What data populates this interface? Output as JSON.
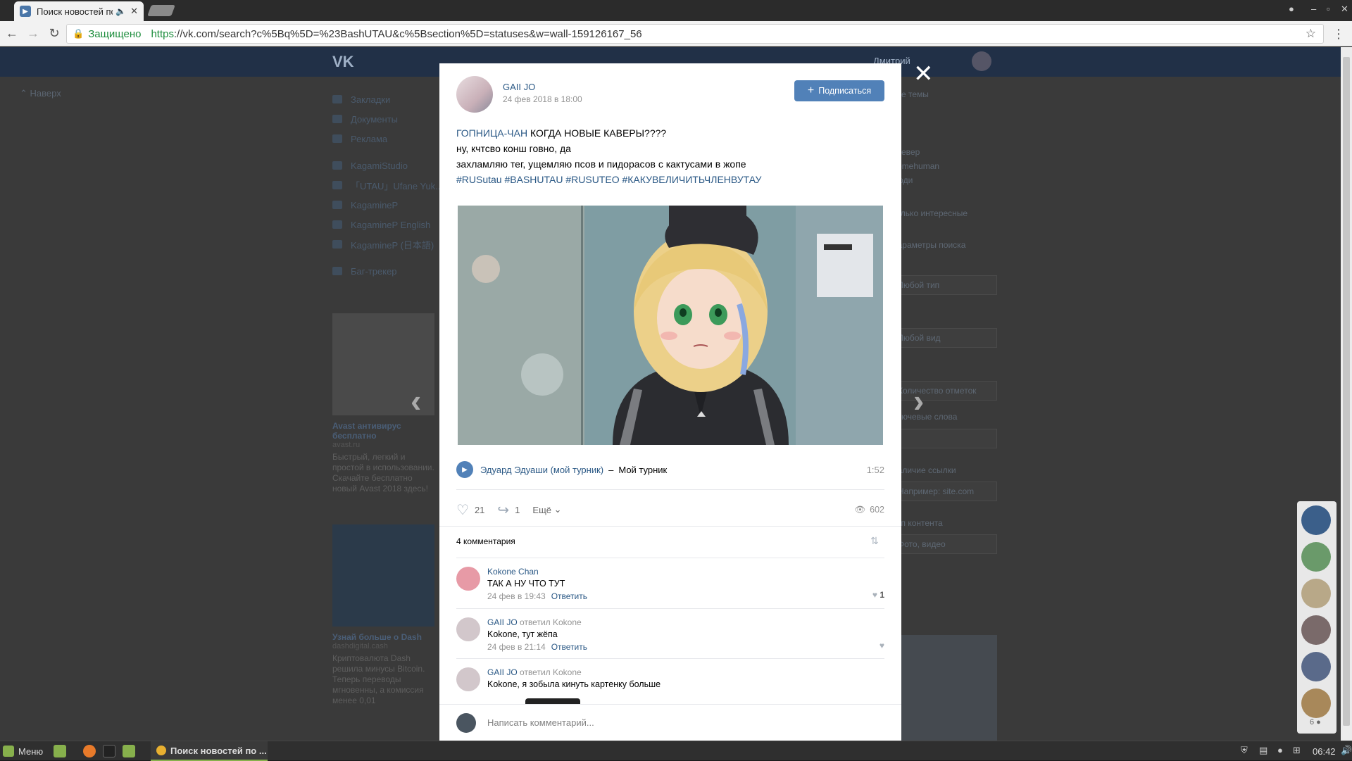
{
  "browser": {
    "tab_title": "Поиск новостей по",
    "secure_label": "Защищено",
    "url_scheme": "https",
    "url_rest": "://vk.com/search?c%5Bq%5D=%23BashUTAU&c%5Bsection%5D=statuses&w=wall-159126167_56"
  },
  "vk": {
    "user_name": "Дмитрий",
    "back_label": "Наверх",
    "left_menu": [
      "Закладки",
      "Документы",
      "Реклама",
      "KagamiStudio",
      "「UTAU」Ufane Yuk...",
      "KagamineP",
      "KagamineP English",
      "KagamineP (日本語)",
      "Баг-трекер"
    ],
    "ad1": {
      "title": "Avast антивирус бесплатно",
      "source": "avast.ru",
      "text": "Быстрый, легкий и простой в использовании. Скачайте бесплатно новый Avast 2018 здесь!"
    },
    "ad2": {
      "title": "Узнай больше о Dash",
      "source": "dashdigital.cash",
      "text": "Криптовалюта Dash решила минусы Bitcoin. Теперь переводы мгновенны, а комиссия менее 0,01"
    },
    "right_panel": [
      "Все темы",
      "Клевер",
      "Somehuman",
      "Люди",
      "Только интересные",
      "Параметры поиска",
      "Любой тип",
      "Любой вид",
      "Количество отметок",
      "Ключевые слова",
      "Наличие ссылки",
      "Например: site.com",
      "Тип контента",
      "Фото, видео"
    ],
    "chat_count": "6"
  },
  "post": {
    "author": "GAII JO",
    "date": "24 фев 2018 в 18:00",
    "subscribe_label": "Подписаться",
    "mention": "ГОПНИЦА-ЧАН",
    "line1_rest": " КОГДА НОВЫЕ КАВЕРЫ????",
    "line2": "ну, кчтсво конш говно, да",
    "line3": "захламляю тег, ущемляю псов и пидорасов с кактусами в жопе",
    "hashtags": "#RUSutau #BASHUTAU #RUSUTEO #КАКУВЕЛИЧИТЬЧЛЕНВУТАУ",
    "audio": {
      "artist": "Эдуард Эдуаши (мой турник)",
      "title": "Мой турник",
      "duration": "1:52"
    },
    "likes": "21",
    "shares": "1",
    "more_label": "Ещё",
    "views": "602",
    "comments_count_label": "4 комментария"
  },
  "comments": [
    {
      "author": "Kokone Chan",
      "reply_to": "",
      "text": "ТАК А НУ ЧТО ТУТ",
      "date": "24 фев в 19:43",
      "reply_label": "Ответить",
      "likes": "1"
    },
    {
      "author": "GAII JO",
      "reply_to": "ответил Kokone",
      "text": "Kokone, тут жёпа",
      "date": "24 фев в 21:14",
      "reply_label": "Ответить",
      "likes": ""
    },
    {
      "author": "GAII JO",
      "reply_to": "ответил Kokone",
      "text": "Kokone, я зобыла кинуть картенку больше",
      "date": "",
      "reply_label": "",
      "likes": ""
    }
  ],
  "reply_placeholder": "Написать комментарий...",
  "taskbar": {
    "menu_label": "Меню",
    "task_label": "Поиск новостей по ...",
    "clock": "06:42"
  }
}
